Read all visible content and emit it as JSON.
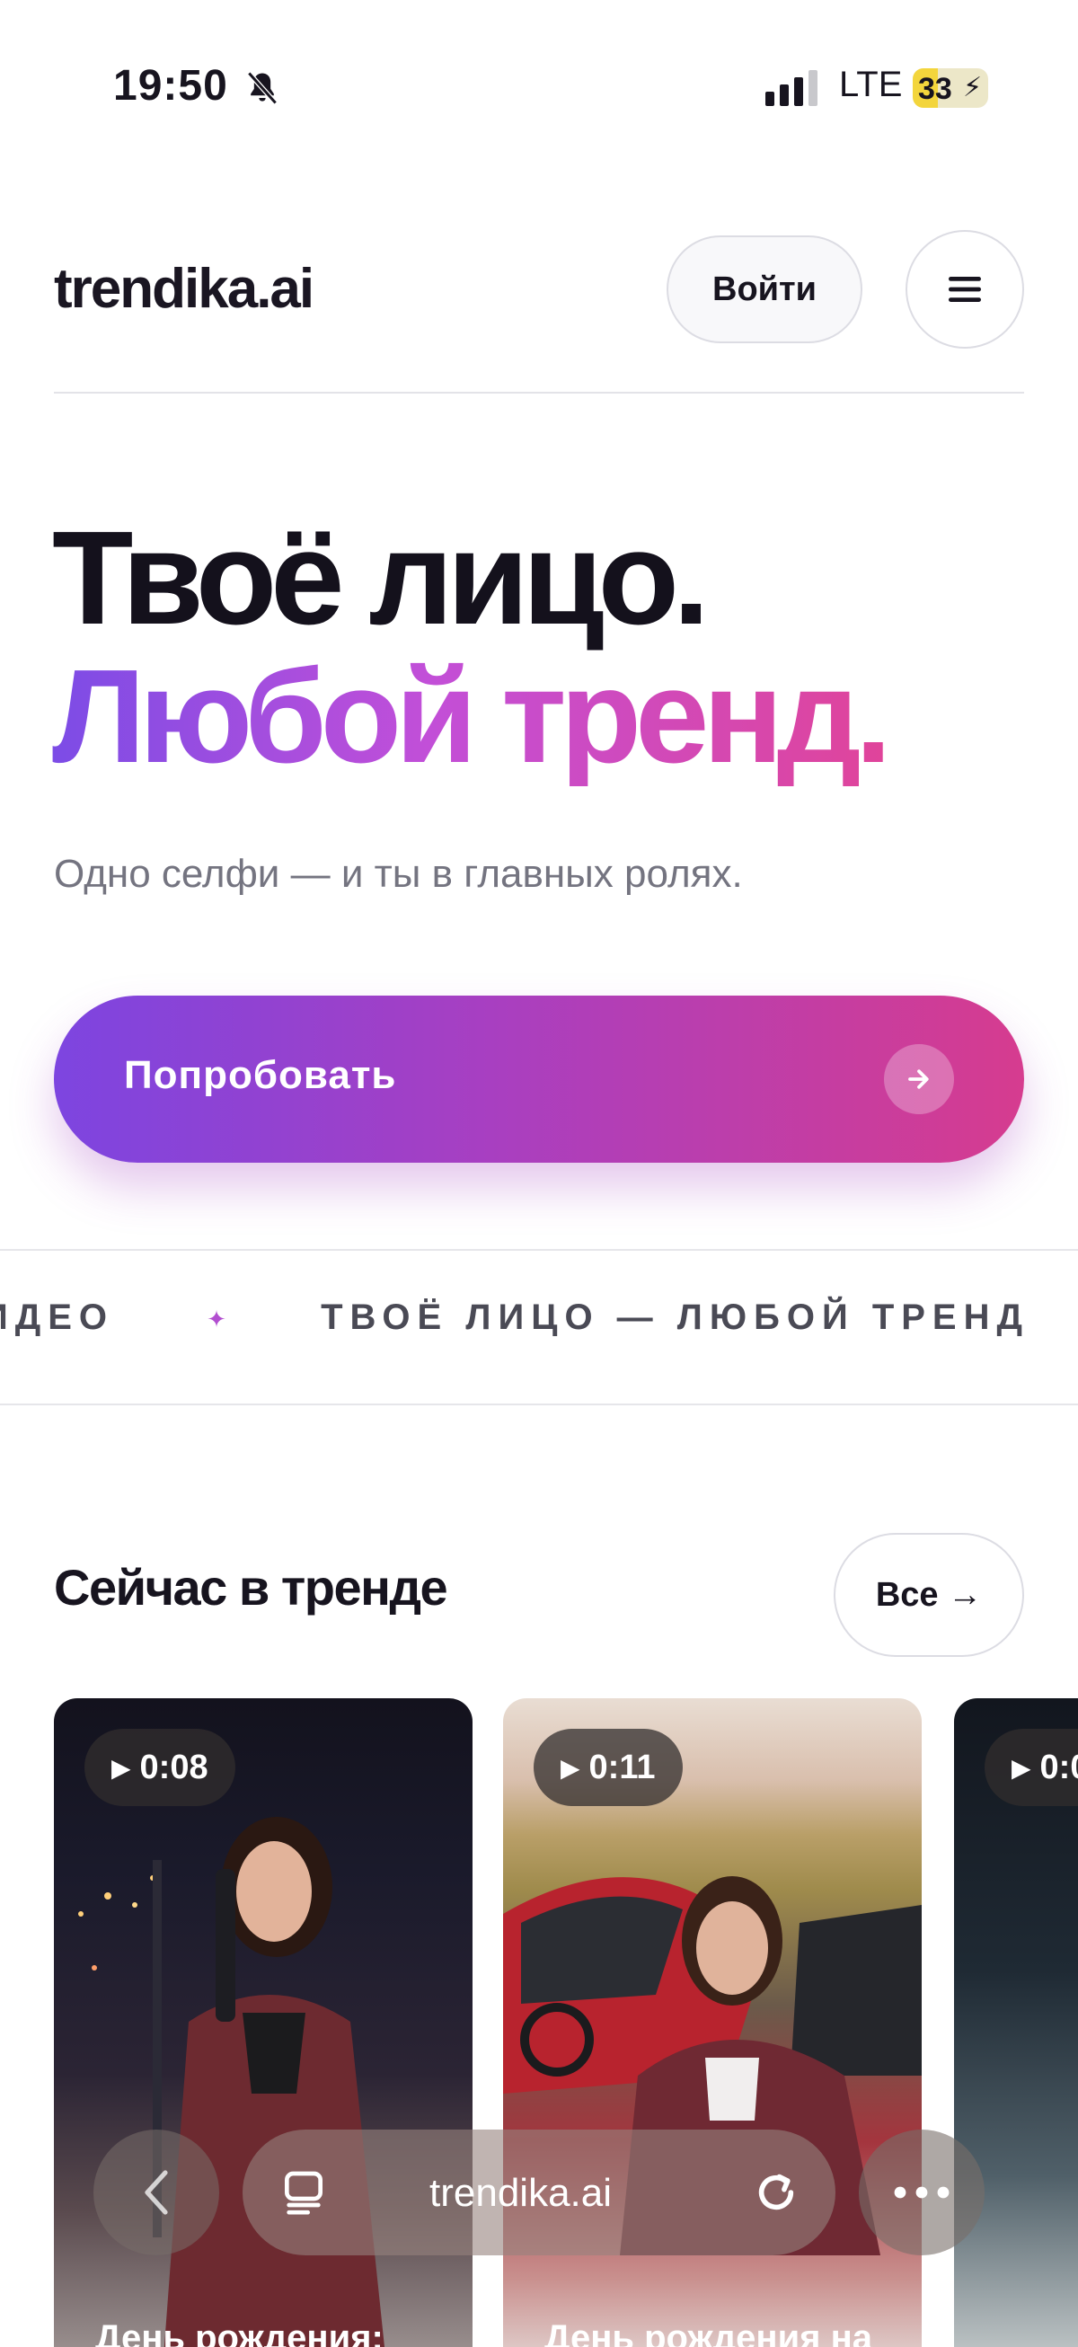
{
  "status_bar": {
    "time": "19:50",
    "network": "LTE",
    "battery": "33",
    "battery_level": 0.33
  },
  "header": {
    "logo": "trendika.ai",
    "login_label": "Войти"
  },
  "hero": {
    "title_line1": "Твоё лицо.",
    "title_line2": "Любой тренд.",
    "subtitle": "Одно селфи — и ты в главных ролях.",
    "cta_label": "Попробовать"
  },
  "ticker": {
    "items": [
      "ИДЕО",
      "ТВОЁ ЛИЦО — ЛЮБОЙ ТРЕНД"
    ]
  },
  "trending": {
    "title": "Сейчас в тренде",
    "all_label": "Все →",
    "cards": [
      {
        "duration": "0:08",
        "caption": "День рождения:"
      },
      {
        "duration": "0:11",
        "caption": "День рождения на"
      },
      {
        "duration": "0:0"
      }
    ]
  },
  "browser": {
    "url": "trendika.ai"
  },
  "colors": {
    "gradient_start": "#7c4ce6",
    "gradient_end": "#e0449a"
  }
}
